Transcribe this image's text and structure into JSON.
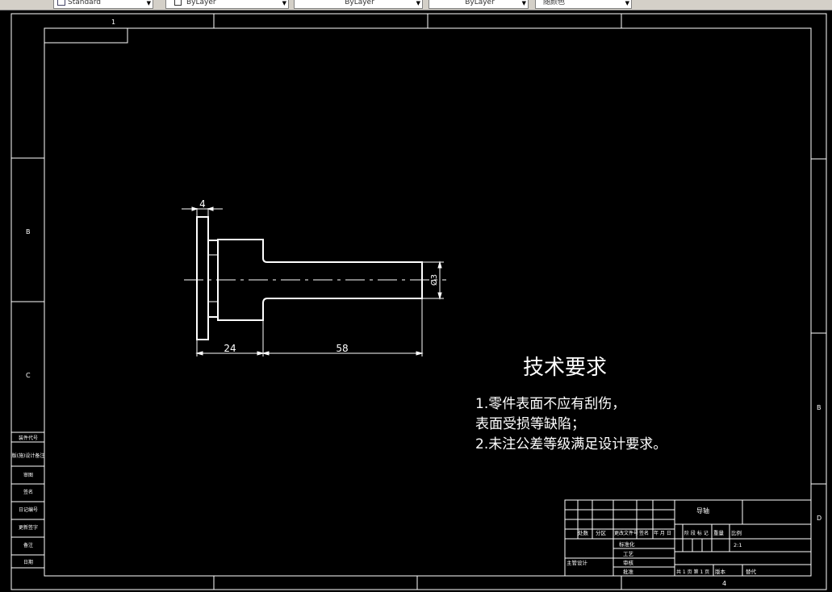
{
  "toolbar": {
    "text_style": "Standard",
    "layer": "ByLayer",
    "linetype": "ByLayer",
    "lineweight": "ByLayer",
    "color": "随颜色"
  },
  "frame": {
    "col_marker_top": "1",
    "col_marker_bottom": "4",
    "row_b_left": "B",
    "row_c_left": "C",
    "row_b_right": "B",
    "row_d_right": "D"
  },
  "dimensions": {
    "flange_thickness": "4",
    "shoulder_length": "24",
    "shaft_length": "58",
    "shaft_diameter": "Ø3"
  },
  "notes": {
    "heading": "技术要求",
    "line1": "1.零件表面不应有刮伤，",
    "line2": "表面受损等缺陷；",
    "line3": "2.未注公差等级满足设计要求。"
  },
  "left_strip": [
    "装件代号",
    "版(施)设计备注",
    "审图",
    "签名",
    "日记编号",
    "更新签字",
    "备注",
    "日期"
  ],
  "title_block": {
    "name": "导轴",
    "rev_headers": [
      "处数",
      "分区",
      "更改文件号",
      "签名",
      "年 月 日"
    ],
    "role_standard": "标准化",
    "role_process": "工艺",
    "role_designer": "主管设计",
    "role_review": "审核",
    "role_approve": "批准",
    "stage_label": "阶 段 标 记",
    "weight_label": "重量",
    "scale_label": "比例",
    "scale_value": "2:1",
    "sheet_info": "共 1 页 第 1 页",
    "version_label": "版本",
    "replace_label": "替代"
  }
}
